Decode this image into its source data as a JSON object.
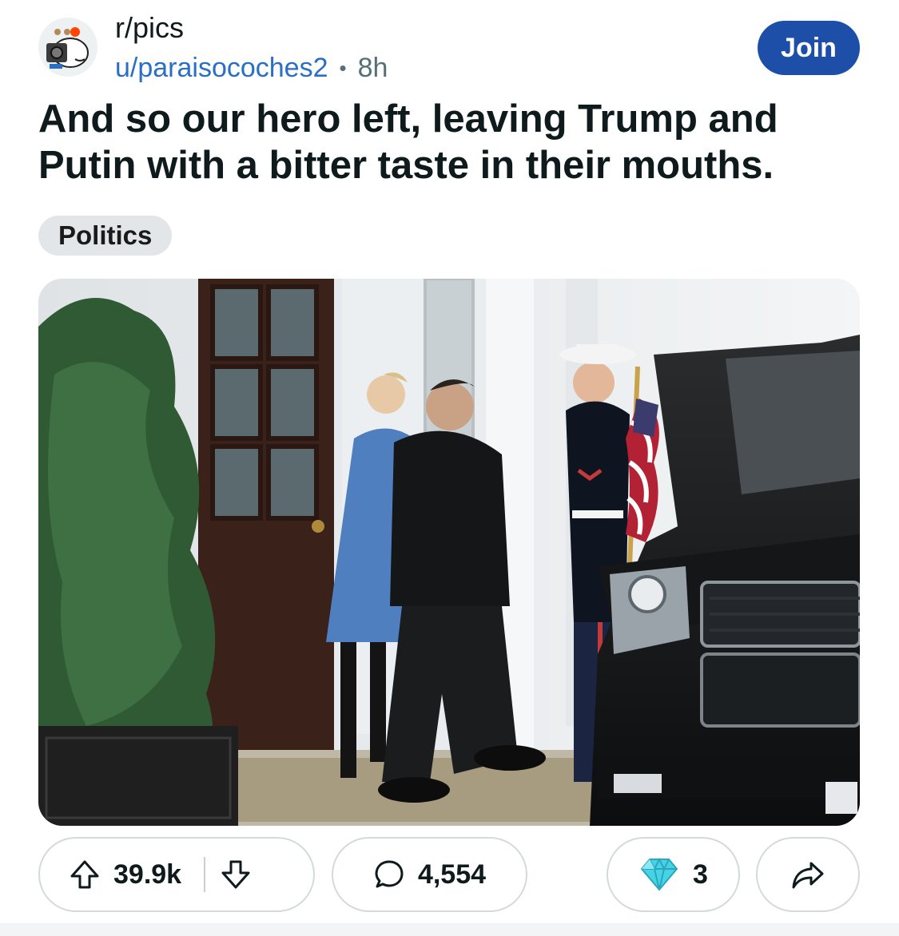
{
  "subreddit": {
    "name": "r/pics",
    "join_label": "Join"
  },
  "author": {
    "username": "u/paraisocoches2",
    "separator": "•",
    "age": "8h"
  },
  "post": {
    "title": "And so our hero left, leaving Trump and Putin with a bitter taste in their mouths.",
    "flair": "Politics"
  },
  "actions": {
    "upvotes": "39.9k",
    "comments": "4,554",
    "awards": "3"
  },
  "colors": {
    "accent": "#1d4fa8",
    "link": "#2a6fc4",
    "muted": "#576f76",
    "flair_bg": "#e3e6e8"
  },
  "icons": {
    "avatar": "subreddit-avatar",
    "upvote": "upvote-arrow-icon",
    "downvote": "downvote-arrow-icon",
    "comment": "comment-bubble-icon",
    "award": "diamond-award-icon",
    "share": "share-arrow-icon"
  }
}
